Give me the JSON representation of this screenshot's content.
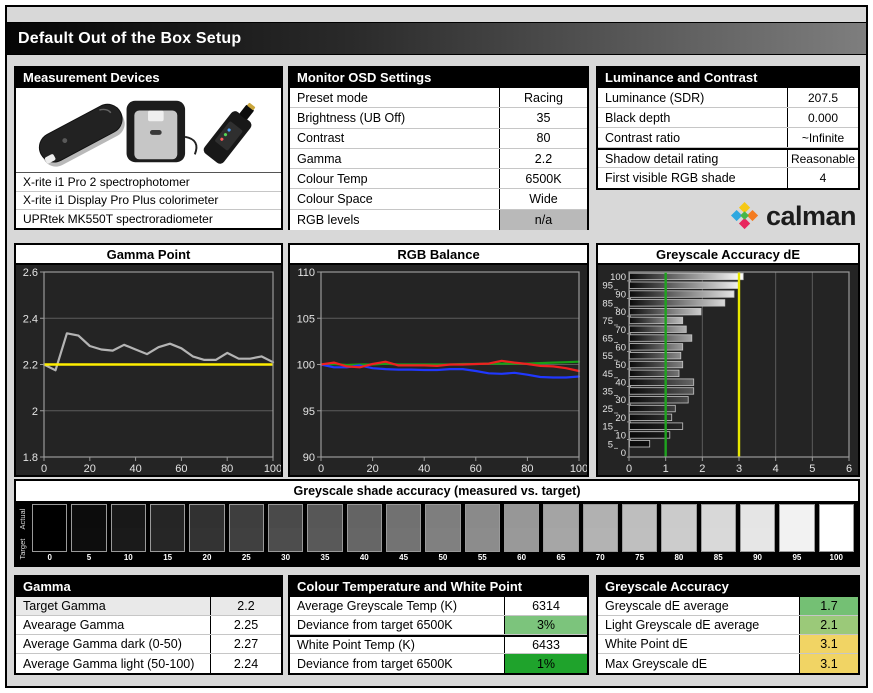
{
  "title": "Default Out of the Box Setup",
  "logo_text": "calman",
  "panels": {
    "devices": {
      "header": "Measurement Devices",
      "items": [
        "X-rite i1 Pro 2 spectrophotomer",
        "X-rite i1 Display Pro Plus colorimeter",
        "UPRtek MK550T spectroradiometer"
      ]
    },
    "osd": {
      "header": "Monitor OSD Settings",
      "rows": [
        {
          "label": "Preset mode",
          "value": "Racing"
        },
        {
          "label": "Brightness (UB Off)",
          "value": "35"
        },
        {
          "label": "Contrast",
          "value": "80"
        },
        {
          "label": "Gamma",
          "value": "2.2"
        },
        {
          "label": "Colour Temp",
          "value": "6500K"
        },
        {
          "label": "Colour Space",
          "value": "Wide"
        },
        {
          "label": "RGB levels",
          "value": "n/a",
          "bg": "#b9b9b9"
        }
      ]
    },
    "luminance": {
      "header": "Luminance and Contrast",
      "rows": [
        {
          "label": "Luminance (SDR)",
          "value": "207.5"
        },
        {
          "label": "Black depth",
          "value": "0.000"
        },
        {
          "label": "Contrast ratio",
          "value": "~Infinite"
        },
        {
          "label": "Shadow detail rating",
          "value": "Reasonable",
          "divider": true
        },
        {
          "label": "First visible RGB shade",
          "value": "4"
        }
      ]
    },
    "gamma_table": {
      "header": "Gamma",
      "rows": [
        {
          "label": "Target Gamma",
          "value": "2.2"
        },
        {
          "label": "Avearage Gamma",
          "value": "2.25"
        },
        {
          "label": "Average Gamma dark (0-50)",
          "value": "2.27"
        },
        {
          "label": "Average Gamma light (50-100)",
          "value": "2.24"
        }
      ]
    },
    "colour_temp": {
      "header": "Colour Temperature and White Point",
      "rows": [
        {
          "label": "Average Greyscale Temp (K)",
          "value": "6314"
        },
        {
          "label": "Deviance from target 6500K",
          "value": "3%",
          "bg": "#7cc47c"
        },
        {
          "label": "White Point Temp (K)",
          "value": "6433",
          "divider": true
        },
        {
          "label": "Deviance from target 6500K",
          "value": "1%",
          "bg": "#1fa32c"
        }
      ]
    },
    "greyscale_table": {
      "header": "Greyscale Accuracy",
      "rows": [
        {
          "label": "Greyscale dE average",
          "value": "1.7",
          "bg": "#74c074"
        },
        {
          "label": "Light Greyscale dE average",
          "value": "2.1",
          "bg": "#9bc979"
        },
        {
          "label": "White Point dE",
          "value": "3.1",
          "bg": "#f1d464"
        },
        {
          "label": "Max Greyscale dE",
          "value": "3.1",
          "bg": "#f1d464"
        }
      ]
    }
  },
  "greyscale_strip": {
    "title": "Greyscale shade accuracy (measured vs. target)",
    "row_labels": [
      "Actual",
      "Target"
    ],
    "levels": [
      0,
      5,
      10,
      15,
      20,
      25,
      30,
      35,
      40,
      45,
      50,
      55,
      60,
      65,
      70,
      75,
      80,
      85,
      90,
      95,
      100
    ]
  },
  "chart_data": [
    {
      "type": "line",
      "title": "Gamma Point",
      "x": [
        0,
        5,
        10,
        15,
        20,
        25,
        30,
        35,
        40,
        45,
        50,
        55,
        60,
        65,
        70,
        75,
        80,
        85,
        90,
        95,
        100
      ],
      "xlim": [
        0,
        100
      ],
      "ylim": [
        1.8,
        2.6
      ],
      "xticks": [
        0,
        20,
        40,
        60,
        80,
        100
      ],
      "yticks": [
        1.8,
        2.0,
        2.2,
        2.4,
        2.6
      ],
      "ytick_labels": [
        "1.8",
        "2",
        "2.2",
        "2.4",
        "2.6"
      ],
      "refline": {
        "y": 2.2,
        "color": "#ffee00",
        "name": "target-gamma-line"
      },
      "series": [
        {
          "name": "Measured gamma",
          "color": "#b4b4b4",
          "values": [
            2.2,
            2.175,
            2.335,
            2.325,
            2.28,
            2.265,
            2.26,
            2.285,
            2.265,
            2.245,
            2.275,
            2.29,
            2.27,
            2.235,
            2.22,
            2.22,
            2.25,
            2.225,
            2.225,
            2.235,
            2.21
          ]
        }
      ]
    },
    {
      "type": "line",
      "title": "RGB Balance",
      "x": [
        0,
        5,
        10,
        15,
        20,
        25,
        30,
        35,
        40,
        45,
        50,
        55,
        60,
        65,
        70,
        75,
        80,
        85,
        90,
        95,
        100
      ],
      "xlim": [
        0,
        100
      ],
      "ylim": [
        90,
        110
      ],
      "xticks": [
        0,
        20,
        40,
        60,
        80,
        100
      ],
      "yticks": [
        90,
        95,
        100,
        105,
        110
      ],
      "ytick_labels": [
        "90",
        "95",
        "100",
        "105",
        "110"
      ],
      "series": [
        {
          "name": "Green",
          "color": "#16a016",
          "values": [
            100,
            100.05,
            99.95,
            100,
            100,
            100.1,
            100,
            100,
            100,
            100,
            100,
            100.05,
            100.05,
            100.1,
            100.1,
            100.1,
            100.1,
            100.15,
            100.2,
            100.25,
            100.3
          ]
        },
        {
          "name": "Blue",
          "color": "#2038ff",
          "values": [
            100,
            99.7,
            99.7,
            99.9,
            99.6,
            99.5,
            99.45,
            99.45,
            99.4,
            99.4,
            99.5,
            99.5,
            99.3,
            99.05,
            99,
            99.1,
            98.9,
            98.65,
            98.6,
            98.6,
            98.7
          ]
        },
        {
          "name": "Red",
          "color": "#ee2020",
          "values": [
            100,
            100.2,
            99.8,
            99.7,
            100.05,
            100.3,
            99.9,
            99.9,
            99.9,
            99.85,
            100,
            100,
            100.05,
            100.1,
            100.4,
            100.2,
            100.05,
            99.85,
            99.8,
            99.6,
            99.3
          ]
        }
      ]
    },
    {
      "type": "bar",
      "title": "Greyscale Accuracy dE",
      "categories": [
        0,
        5,
        10,
        15,
        20,
        25,
        30,
        35,
        40,
        45,
        50,
        55,
        60,
        65,
        70,
        75,
        80,
        85,
        90,
        95,
        100
      ],
      "values": [
        0,
        0.55,
        1.1,
        1.45,
        1.15,
        1.25,
        1.6,
        1.75,
        1.75,
        1.35,
        1.45,
        1.4,
        1.45,
        1.7,
        1.55,
        1.45,
        1.95,
        2.6,
        2.85,
        3.0,
        3.1
      ],
      "xlim": [
        0,
        6
      ],
      "xticks": [
        0,
        1,
        2,
        3,
        4,
        5,
        6
      ],
      "reflines": [
        {
          "x": 1,
          "color": "#1fa41f",
          "name": "target-line"
        },
        {
          "x": 3,
          "color": "#e8e800",
          "name": "tolerance-line"
        }
      ]
    }
  ]
}
